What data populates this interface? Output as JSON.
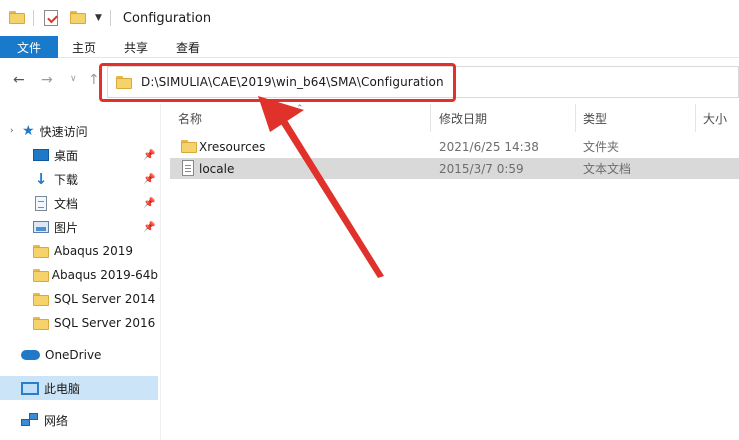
{
  "window": {
    "title": "Configuration"
  },
  "ribbon": {
    "tabs": [
      {
        "label": "文件"
      },
      {
        "label": "主页"
      },
      {
        "label": "共享"
      },
      {
        "label": "查看"
      }
    ]
  },
  "address_bar": {
    "path": "D:\\SIMULIA\\CAE\\2019\\win_b64\\SMA\\Configuration"
  },
  "nav_pane": {
    "quick_access": "快速访问",
    "pinned": [
      {
        "label": "桌面",
        "icon": "desktop-icon"
      },
      {
        "label": "下载",
        "icon": "download-icon"
      },
      {
        "label": "文档",
        "icon": "documents-icon"
      },
      {
        "label": "图片",
        "icon": "pictures-icon"
      }
    ],
    "folders": [
      {
        "label": "Abaqus 2019"
      },
      {
        "label": "Abaqus 2019-64b"
      },
      {
        "label": "SQL Server 2014"
      },
      {
        "label": "SQL Server 2016"
      }
    ],
    "onedrive": "OneDrive",
    "this_pc": "此电脑",
    "network": "网络"
  },
  "file_list": {
    "columns": [
      "名称",
      "修改日期",
      "类型",
      "大小"
    ],
    "rows": [
      {
        "name": "Xresources",
        "date": "2021/6/25 14:38",
        "type": "文件夹",
        "icon": "folder-icon"
      },
      {
        "name": "locale",
        "date": "2015/3/7 0:59",
        "type": "文本文档",
        "icon": "text-file-icon"
      }
    ]
  },
  "colors": {
    "file_tab": "#1979ca",
    "annotation": "#e0312b",
    "selection": "#cce4f7",
    "folder": "#f6d26a"
  }
}
